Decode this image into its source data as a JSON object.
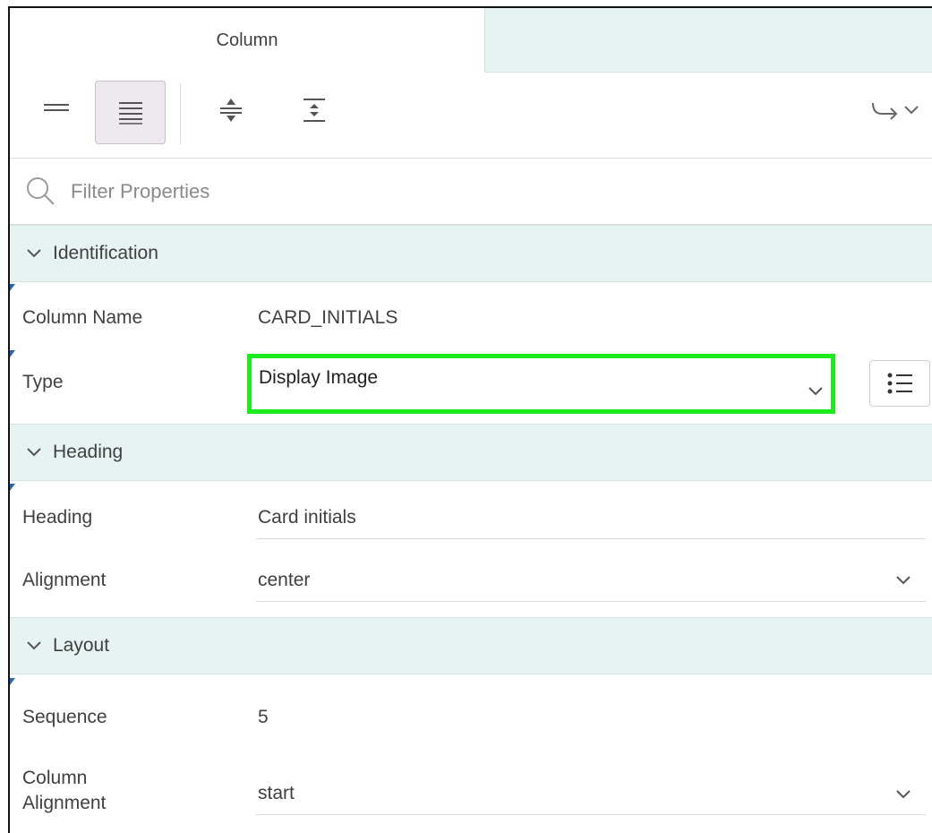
{
  "tabs": {
    "active": "Column"
  },
  "filter": {
    "placeholder": "Filter Properties"
  },
  "groups": {
    "identification": {
      "label": "Identification",
      "column_name": {
        "label": "Column Name",
        "value": "CARD_INITIALS"
      },
      "type": {
        "label": "Type",
        "value": "Display Image"
      }
    },
    "heading": {
      "label": "Heading",
      "heading": {
        "label": "Heading",
        "value": "Card initials"
      },
      "alignment": {
        "label": "Alignment",
        "value": "center"
      }
    },
    "layout": {
      "label": "Layout",
      "sequence": {
        "label": "Sequence",
        "value": "5"
      },
      "column_alignment": {
        "label_line1": "Column",
        "label_line2": "Alignment",
        "value": "start"
      }
    }
  },
  "icons": {
    "collapsed_view": "collapsed-view-icon",
    "expanded_view": "expanded-view-icon",
    "expand_all": "expand-all-icon",
    "collapse_all": "collapse-all-icon",
    "go_to_group": "go-to-group-icon",
    "search": "search-icon",
    "list": "list-icon"
  },
  "colors": {
    "highlight": "#1eeb1e",
    "group_bg": "#e6f3f1",
    "active_toggle_bg": "#eee8ef",
    "marker": "#1f6ab5"
  }
}
